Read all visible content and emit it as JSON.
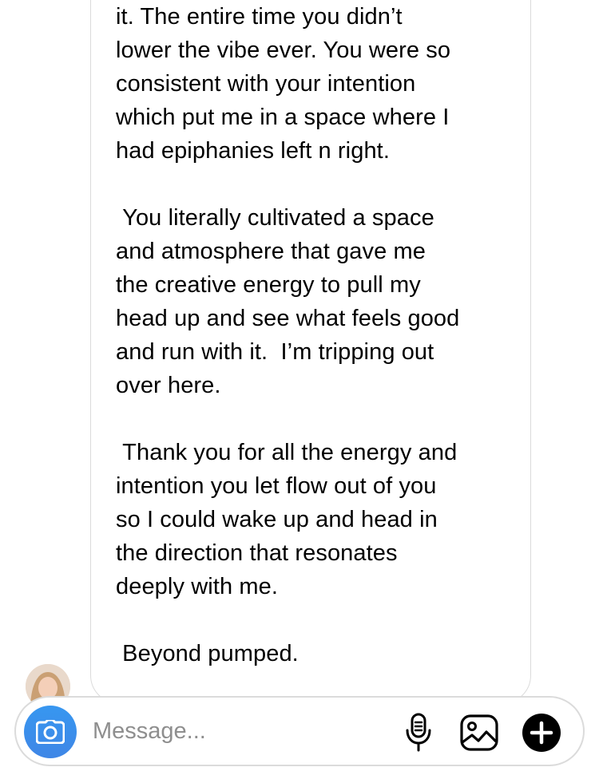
{
  "message": {
    "paragraphs": [
      "it. The entire time you didn’t\nlower the vibe ever. You were so\nconsistent with your intention\nwhich put me in a space where I\nhad epiphanies left n right.",
      " You literally cultivated a space\nand atmosphere that gave me\nthe creative energy to pull my\nhead up and see what feels good\nand run with it.  I’m tripping out\nover here.",
      " Thank you for all the energy and\nintention you let flow out of you\nso I could wake up and head in\nthe direction that resonates\ndeeply with me.",
      " Beyond pumped."
    ]
  },
  "composer": {
    "placeholder": "Message...",
    "icons": {
      "camera": "camera-icon",
      "mic": "microphone-icon",
      "gallery": "image-gallery-icon",
      "plus": "plus-circle-icon"
    }
  },
  "colors": {
    "camera_button": "#3797f0",
    "bubble_border": "#dbdbdb",
    "placeholder": "#8e8e8e"
  }
}
